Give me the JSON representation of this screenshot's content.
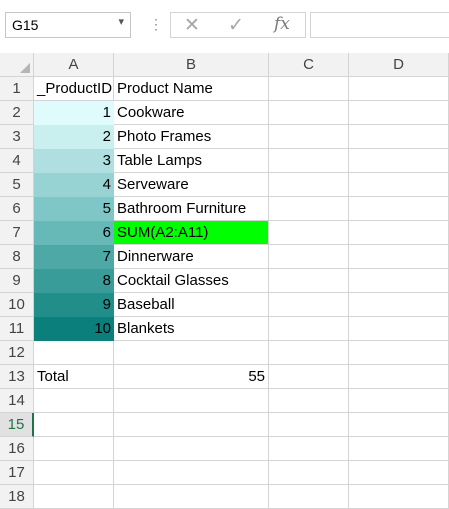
{
  "formula_bar": {
    "name_box": "G15",
    "name_box_arrow": "▾",
    "separator": "⋮",
    "cancel_symbol": "✕",
    "enter_symbol": "✓",
    "fx_symbol": "fx",
    "formula_value": ""
  },
  "columns": [
    "A",
    "B",
    "C",
    "D"
  ],
  "rows": [
    "1",
    "2",
    "3",
    "4",
    "5",
    "6",
    "7",
    "8",
    "9",
    "10",
    "11",
    "12",
    "13",
    "14",
    "15",
    "16",
    "17",
    "18"
  ],
  "selected_row": "15",
  "cells": {
    "A1": "_ProductID",
    "B1": "Product Name",
    "A2": "1",
    "B2": "Cookware",
    "A3": "2",
    "B3": "Photo Frames",
    "A4": "3",
    "B4": "Table Lamps",
    "A5": "4",
    "B5": "Serveware",
    "A6": "5",
    "B6": "Bathroom Furniture",
    "A7": "6",
    "B7": "SUM(A2:A11)",
    "A8": "7",
    "B8": "Dinnerware",
    "A9": "8",
    "B9": "Cocktail Glasses",
    "A10": "9",
    "B10": "Baseball",
    "A11": "10",
    "B11": "Blankets",
    "A13": "Total",
    "B13": "55"
  },
  "colors": {
    "data_bar_scale": [
      "#e0fbfb",
      "#c9efef",
      "#afdfe0",
      "#96d3d2",
      "#7fc7c6",
      "#66b9b7",
      "#4ea9a6",
      "#399c99",
      "#218e8a",
      "#0a7f7b"
    ],
    "highlight_cell": "#00ff00",
    "selection_accent": "#217346"
  }
}
